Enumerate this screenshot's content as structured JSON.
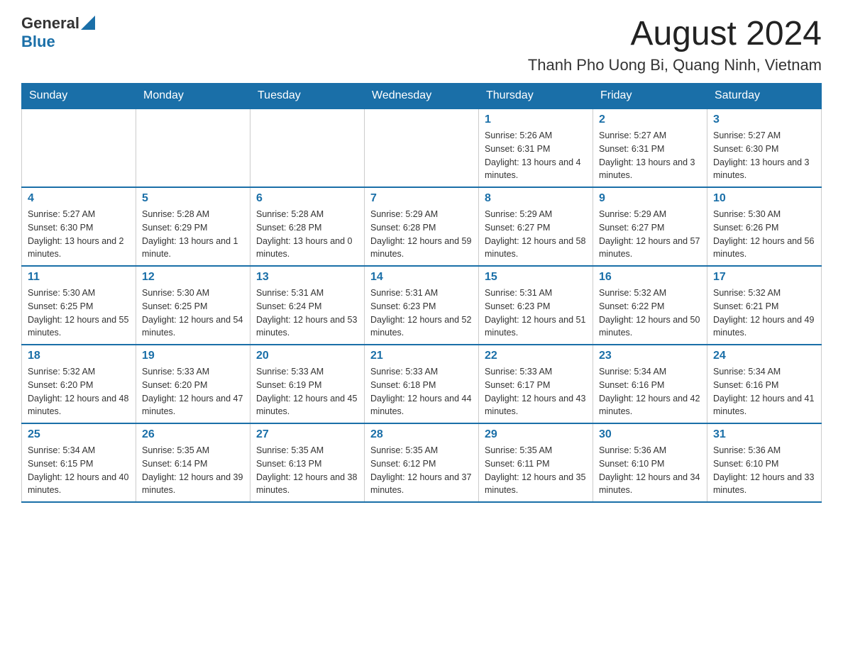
{
  "header": {
    "logo_general": "General",
    "logo_blue": "Blue",
    "month_title": "August 2024",
    "location": "Thanh Pho Uong Bi, Quang Ninh, Vietnam"
  },
  "days_of_week": [
    "Sunday",
    "Monday",
    "Tuesday",
    "Wednesday",
    "Thursday",
    "Friday",
    "Saturday"
  ],
  "weeks": [
    [
      {
        "day": "",
        "info": ""
      },
      {
        "day": "",
        "info": ""
      },
      {
        "day": "",
        "info": ""
      },
      {
        "day": "",
        "info": ""
      },
      {
        "day": "1",
        "info": "Sunrise: 5:26 AM\nSunset: 6:31 PM\nDaylight: 13 hours and 4 minutes."
      },
      {
        "day": "2",
        "info": "Sunrise: 5:27 AM\nSunset: 6:31 PM\nDaylight: 13 hours and 3 minutes."
      },
      {
        "day": "3",
        "info": "Sunrise: 5:27 AM\nSunset: 6:30 PM\nDaylight: 13 hours and 3 minutes."
      }
    ],
    [
      {
        "day": "4",
        "info": "Sunrise: 5:27 AM\nSunset: 6:30 PM\nDaylight: 13 hours and 2 minutes."
      },
      {
        "day": "5",
        "info": "Sunrise: 5:28 AM\nSunset: 6:29 PM\nDaylight: 13 hours and 1 minute."
      },
      {
        "day": "6",
        "info": "Sunrise: 5:28 AM\nSunset: 6:28 PM\nDaylight: 13 hours and 0 minutes."
      },
      {
        "day": "7",
        "info": "Sunrise: 5:29 AM\nSunset: 6:28 PM\nDaylight: 12 hours and 59 minutes."
      },
      {
        "day": "8",
        "info": "Sunrise: 5:29 AM\nSunset: 6:27 PM\nDaylight: 12 hours and 58 minutes."
      },
      {
        "day": "9",
        "info": "Sunrise: 5:29 AM\nSunset: 6:27 PM\nDaylight: 12 hours and 57 minutes."
      },
      {
        "day": "10",
        "info": "Sunrise: 5:30 AM\nSunset: 6:26 PM\nDaylight: 12 hours and 56 minutes."
      }
    ],
    [
      {
        "day": "11",
        "info": "Sunrise: 5:30 AM\nSunset: 6:25 PM\nDaylight: 12 hours and 55 minutes."
      },
      {
        "day": "12",
        "info": "Sunrise: 5:30 AM\nSunset: 6:25 PM\nDaylight: 12 hours and 54 minutes."
      },
      {
        "day": "13",
        "info": "Sunrise: 5:31 AM\nSunset: 6:24 PM\nDaylight: 12 hours and 53 minutes."
      },
      {
        "day": "14",
        "info": "Sunrise: 5:31 AM\nSunset: 6:23 PM\nDaylight: 12 hours and 52 minutes."
      },
      {
        "day": "15",
        "info": "Sunrise: 5:31 AM\nSunset: 6:23 PM\nDaylight: 12 hours and 51 minutes."
      },
      {
        "day": "16",
        "info": "Sunrise: 5:32 AM\nSunset: 6:22 PM\nDaylight: 12 hours and 50 minutes."
      },
      {
        "day": "17",
        "info": "Sunrise: 5:32 AM\nSunset: 6:21 PM\nDaylight: 12 hours and 49 minutes."
      }
    ],
    [
      {
        "day": "18",
        "info": "Sunrise: 5:32 AM\nSunset: 6:20 PM\nDaylight: 12 hours and 48 minutes."
      },
      {
        "day": "19",
        "info": "Sunrise: 5:33 AM\nSunset: 6:20 PM\nDaylight: 12 hours and 47 minutes."
      },
      {
        "day": "20",
        "info": "Sunrise: 5:33 AM\nSunset: 6:19 PM\nDaylight: 12 hours and 45 minutes."
      },
      {
        "day": "21",
        "info": "Sunrise: 5:33 AM\nSunset: 6:18 PM\nDaylight: 12 hours and 44 minutes."
      },
      {
        "day": "22",
        "info": "Sunrise: 5:33 AM\nSunset: 6:17 PM\nDaylight: 12 hours and 43 minutes."
      },
      {
        "day": "23",
        "info": "Sunrise: 5:34 AM\nSunset: 6:16 PM\nDaylight: 12 hours and 42 minutes."
      },
      {
        "day": "24",
        "info": "Sunrise: 5:34 AM\nSunset: 6:16 PM\nDaylight: 12 hours and 41 minutes."
      }
    ],
    [
      {
        "day": "25",
        "info": "Sunrise: 5:34 AM\nSunset: 6:15 PM\nDaylight: 12 hours and 40 minutes."
      },
      {
        "day": "26",
        "info": "Sunrise: 5:35 AM\nSunset: 6:14 PM\nDaylight: 12 hours and 39 minutes."
      },
      {
        "day": "27",
        "info": "Sunrise: 5:35 AM\nSunset: 6:13 PM\nDaylight: 12 hours and 38 minutes."
      },
      {
        "day": "28",
        "info": "Sunrise: 5:35 AM\nSunset: 6:12 PM\nDaylight: 12 hours and 37 minutes."
      },
      {
        "day": "29",
        "info": "Sunrise: 5:35 AM\nSunset: 6:11 PM\nDaylight: 12 hours and 35 minutes."
      },
      {
        "day": "30",
        "info": "Sunrise: 5:36 AM\nSunset: 6:10 PM\nDaylight: 12 hours and 34 minutes."
      },
      {
        "day": "31",
        "info": "Sunrise: 5:36 AM\nSunset: 6:10 PM\nDaylight: 12 hours and 33 minutes."
      }
    ]
  ]
}
